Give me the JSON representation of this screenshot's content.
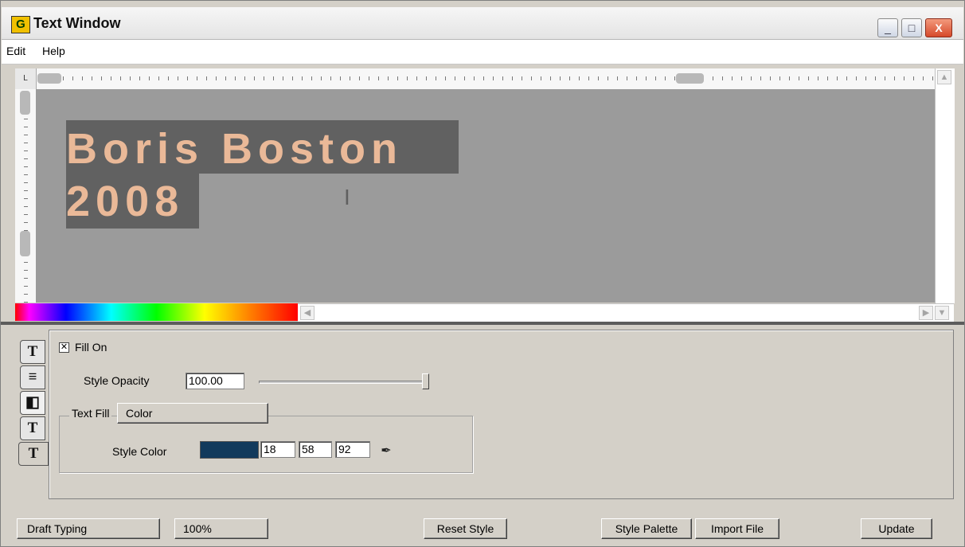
{
  "window": {
    "icon_letter": "G",
    "title": "Text Window",
    "minimize_glyph": "_",
    "maximize_glyph": "□",
    "close_glyph": "X"
  },
  "menu": [
    {
      "label": "Edit"
    },
    {
      "label": "Help"
    }
  ],
  "canvas": {
    "line1": "Boris Boston",
    "line2": "2008",
    "text_color": "#eab998",
    "highlight_color": "#616161",
    "background_color": "#9b9b9b"
  },
  "side_tabs": [
    {
      "icon": "text-icon",
      "glyph": "T"
    },
    {
      "icon": "align-icon",
      "glyph": "≡"
    },
    {
      "icon": "fill-icon",
      "glyph": "◧"
    },
    {
      "icon": "outline-text-icon",
      "glyph": "T"
    },
    {
      "icon": "shadow-text-icon",
      "glyph": "T"
    }
  ],
  "fill": {
    "fill_on_label": "Fill On",
    "fill_on_checked": true,
    "opacity_label": "Style Opacity",
    "opacity_value": "100.00",
    "opacity_level": 1.0,
    "text_fill_label": "Text Fill",
    "text_fill_value": "Color",
    "style_color_label": "Style Color",
    "style_color_hex": "#123a5c",
    "rgb": [
      "18",
      "58",
      "92"
    ]
  },
  "bottom": {
    "draft_typing": "Draft Typing",
    "zoom": "100%",
    "reset_style": "Reset Style",
    "style_palette": "Style Palette",
    "import_file": "Import File",
    "update": "Update"
  }
}
